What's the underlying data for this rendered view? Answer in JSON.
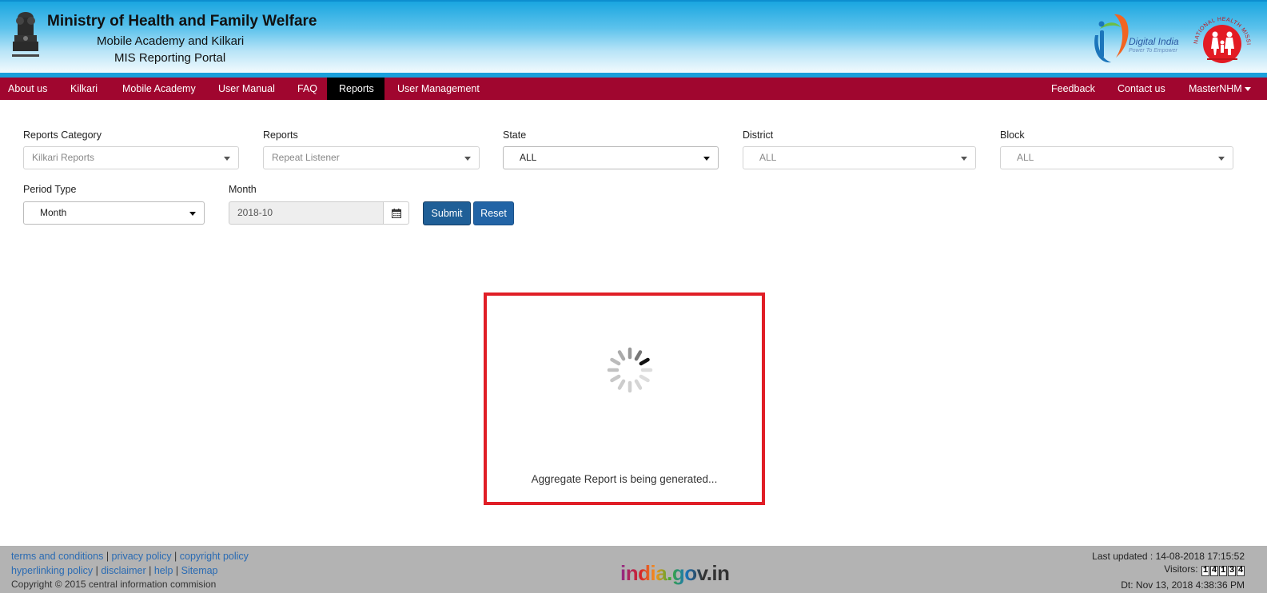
{
  "header": {
    "title": "Ministry of Health and Family Welfare",
    "subtitle_line1": "Mobile Academy and Kilkari",
    "subtitle_line2": "MIS Reporting Portal",
    "digital_india_title": "Digital India",
    "digital_india_tagline": "Power To Empower",
    "nhm_text": "NATIONAL HEALTH MISSION"
  },
  "nav": {
    "left": [
      {
        "label": "About us"
      },
      {
        "label": "Kilkari"
      },
      {
        "label": "Mobile Academy"
      },
      {
        "label": "User Manual"
      },
      {
        "label": "FAQ"
      },
      {
        "label": "Reports",
        "active": true
      },
      {
        "label": "User Management"
      }
    ],
    "right": [
      {
        "label": "Feedback"
      },
      {
        "label": "Contact us"
      },
      {
        "label": "MasterNHM"
      }
    ]
  },
  "form": {
    "reports_category": {
      "label": "Reports Category",
      "value": "Kilkari Reports"
    },
    "reports": {
      "label": "Reports",
      "value": "Repeat Listener"
    },
    "state": {
      "label": "State",
      "value": "ALL"
    },
    "district": {
      "label": "District",
      "value": "ALL"
    },
    "block": {
      "label": "Block",
      "value": "ALL"
    },
    "period_type": {
      "label": "Period Type",
      "value": "Month"
    },
    "month": {
      "label": "Month",
      "value": "2018-10"
    },
    "submit_label": "Submit",
    "reset_label": "Reset"
  },
  "loading": {
    "message": "Aggregate Report is being generated...",
    "border_color": "#e01e26"
  },
  "footer": {
    "links_row1": [
      "terms and conditions",
      "privacy policy",
      "copyright policy"
    ],
    "links_row2": [
      "hyperlinking policy",
      "disclaimer",
      "help",
      "Sitemap"
    ],
    "copyright": "Copyright © 2015 central information commision",
    "last_updated": "Last updated : 14-08-2018 17:15:52",
    "visitors_label": "Visitors:",
    "visitor_digits": [
      "1",
      "4",
      "1",
      "3",
      "4"
    ],
    "date_line": "Dt: Nov 13, 2018 4:38:36 PM",
    "india_gov": "india.gov.in"
  },
  "colors": {
    "nav_bg": "#a0062f",
    "nav_active": "#000000",
    "submit": "#1f5f97",
    "reset": "#2264a6",
    "footer_bg": "#b3b3b3",
    "link": "#2a6bb3"
  }
}
